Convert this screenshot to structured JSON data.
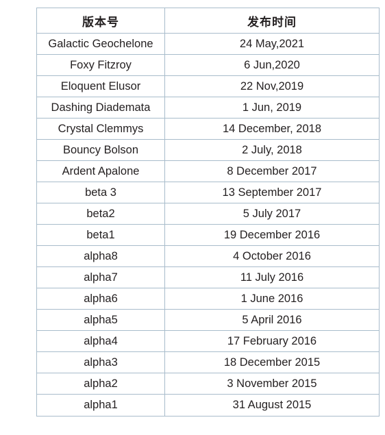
{
  "table": {
    "headers": [
      "版本号",
      "发布时间"
    ],
    "rows": [
      {
        "version": "Galactic Geochelone",
        "date": "24 May,2021"
      },
      {
        "version": "Foxy Fitzroy",
        "date": "6 Jun,2020"
      },
      {
        "version": "Eloquent Elusor",
        "date": "22 Nov,2019"
      },
      {
        "version": "Dashing Diademata",
        "date": "1 Jun, 2019"
      },
      {
        "version": "Crystal Clemmys",
        "date": "14 December, 2018"
      },
      {
        "version": "Bouncy Bolson",
        "date": "2 July, 2018"
      },
      {
        "version": "Ardent Apalone",
        "date": "8 December 2017"
      },
      {
        "version": "beta 3",
        "date": "13 September 2017"
      },
      {
        "version": "beta2",
        "date": "5 July 2017"
      },
      {
        "version": "beta1",
        "date": "19 December 2016"
      },
      {
        "version": "alpha8",
        "date": "4 October 2016"
      },
      {
        "version": "alpha7",
        "date": "11 July 2016"
      },
      {
        "version": "alpha6",
        "date": "1 June 2016"
      },
      {
        "version": "alpha5",
        "date": "5 April 2016"
      },
      {
        "version": "alpha4",
        "date": "17 February 2016"
      },
      {
        "version": "alpha3",
        "date": "18 December 2015"
      },
      {
        "version": "alpha2",
        "date": "3 November 2015"
      },
      {
        "version": "alpha1",
        "date": "31 August 2015"
      }
    ]
  },
  "colors": {
    "border": "#a8bccb",
    "text": "#231f20",
    "background": "#ffffff"
  }
}
